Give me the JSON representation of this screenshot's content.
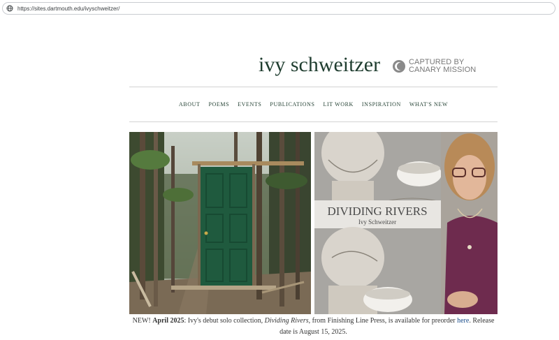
{
  "browser": {
    "url": "https://sites.dartmouth.edu/ivyschweitzer/",
    "icon": "globe-icon"
  },
  "header": {
    "site_title": "ivy schweitzer",
    "badge": {
      "icon": "canary-icon",
      "line1": "CAPTURED BY",
      "line2": "CANARY MISSION"
    }
  },
  "nav": {
    "items": [
      "ABOUT",
      "POEMS",
      "EVENTS",
      "PUBLICATIONS",
      "LIT WORK",
      "INSPIRATION",
      "WHAT'S NEW"
    ]
  },
  "book_cover": {
    "title": "DIVIDING RIVERS",
    "author": "Ivy Schweitzer"
  },
  "caption": {
    "new_label": "NEW!",
    "date": "April 2025",
    "text1": ": Ivy's debut solo collection, ",
    "book_title": "Dividing Rivers",
    "text2": ", from Finishing Line Press, is available for preorder ",
    "link_text": "here",
    "text3": ". Release date is August 15, 2025."
  },
  "colors": {
    "title": "#1f3d2f",
    "door": "#1f5a3e",
    "link": "#1a4c8a",
    "badge_gray": "#777777"
  }
}
